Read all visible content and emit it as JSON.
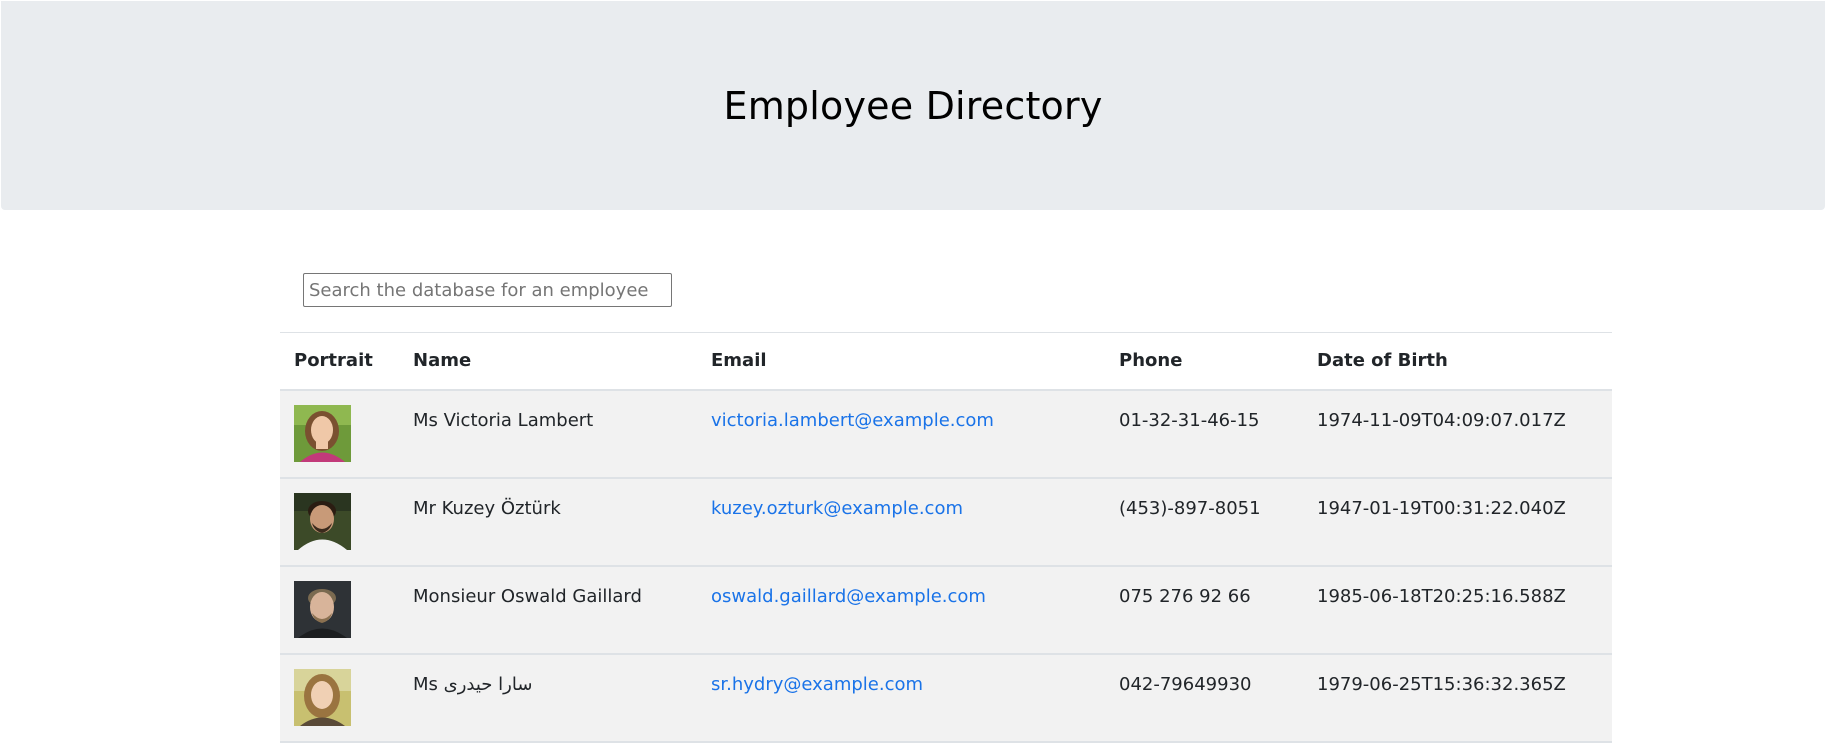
{
  "header": {
    "title": "Employee Directory"
  },
  "search": {
    "placeholder": "Search the database for an employee",
    "value": ""
  },
  "table": {
    "columns": [
      "Portrait",
      "Name",
      "Email",
      "Phone",
      "Date of Birth"
    ],
    "rows": [
      {
        "name": "Ms Victoria Lambert",
        "email": "victoria.lambert@example.com",
        "phone": "01-32-31-46-15",
        "dob": "1974-11-09T04:09:07.017Z"
      },
      {
        "name": "Mr Kuzey Öztürk",
        "email": "kuzey.ozturk@example.com",
        "phone": "(453)-897-8051",
        "dob": "1947-01-19T00:31:22.040Z"
      },
      {
        "name": "Monsieur Oswald Gaillard",
        "email": "oswald.gaillard@example.com",
        "phone": "075 276 92 66",
        "dob": "1985-06-18T20:25:16.588Z"
      },
      {
        "name": "Ms سارا حیدری",
        "email": "sr.hydry@example.com",
        "phone": "042-79649930",
        "dob": "1979-06-25T15:36:32.365Z"
      }
    ]
  }
}
